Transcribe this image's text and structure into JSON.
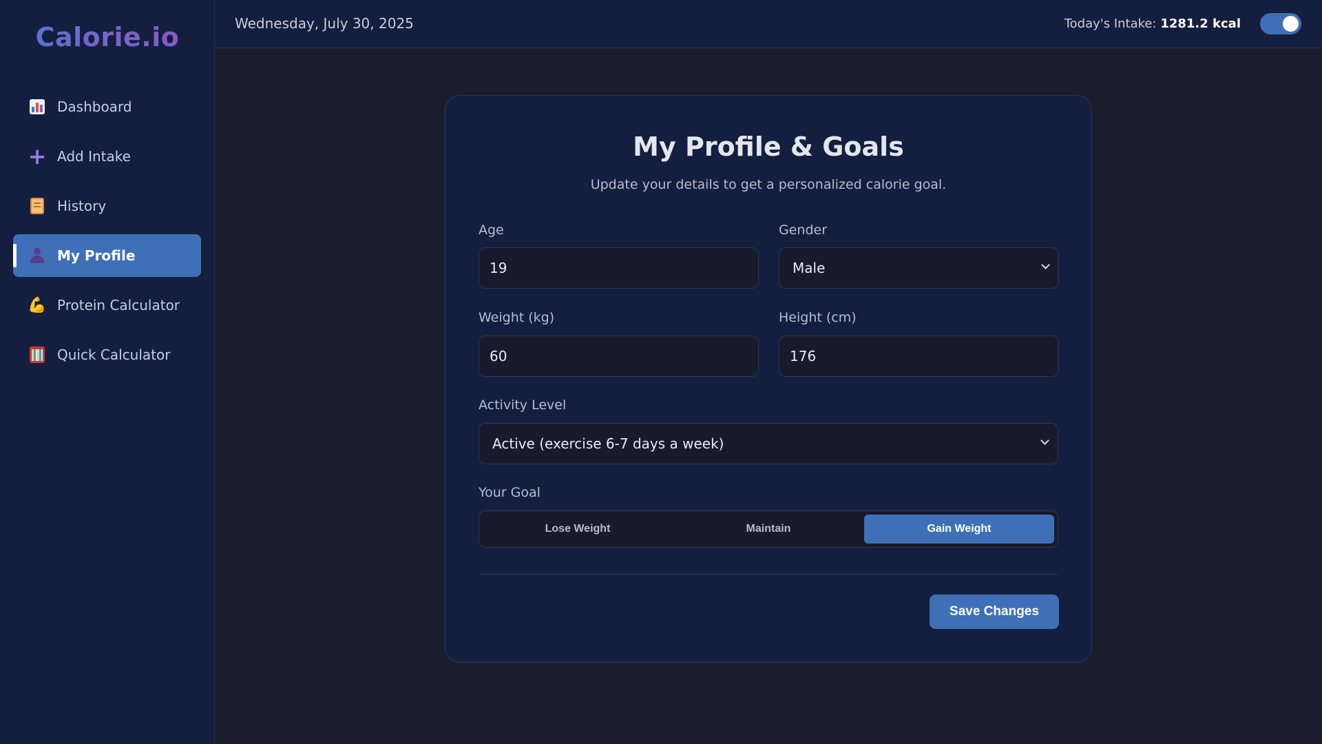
{
  "app": {
    "logo": "Calorie.io"
  },
  "sidebar": {
    "items": [
      {
        "label": "Dashboard",
        "icon": "bar-chart-icon"
      },
      {
        "label": "Add Intake",
        "icon": "plus-icon"
      },
      {
        "label": "History",
        "icon": "scroll-icon"
      },
      {
        "label": "My Profile",
        "icon": "user-icon",
        "active": true
      },
      {
        "label": "Protein Calculator",
        "icon": "flexed-arm-icon"
      },
      {
        "label": "Quick Calculator",
        "icon": "abacus-icon"
      }
    ]
  },
  "header": {
    "date": "Wednesday, July 30, 2025",
    "intake_label": "Today's Intake:",
    "intake_value": "1281.2 kcal",
    "theme_toggle_on": true
  },
  "profile": {
    "title": "My Profile & Goals",
    "subtitle": "Update your details to get a personalized calorie goal.",
    "age_label": "Age",
    "age_value": "19",
    "gender_label": "Gender",
    "gender_value": "Male",
    "weight_label": "Weight (kg)",
    "weight_value": "60",
    "height_label": "Height (cm)",
    "height_value": "176",
    "activity_label": "Activity Level",
    "activity_value": "Active (exercise 6-7 days a week)",
    "goal_label": "Your Goal",
    "goal_options": [
      "Lose Weight",
      "Maintain",
      "Gain Weight"
    ],
    "goal_selected": "Gain Weight",
    "save_label": "Save Changes"
  },
  "colors": {
    "accent": "#3f70b7",
    "background": "#1b1d2d",
    "panel": "#141f3f"
  }
}
